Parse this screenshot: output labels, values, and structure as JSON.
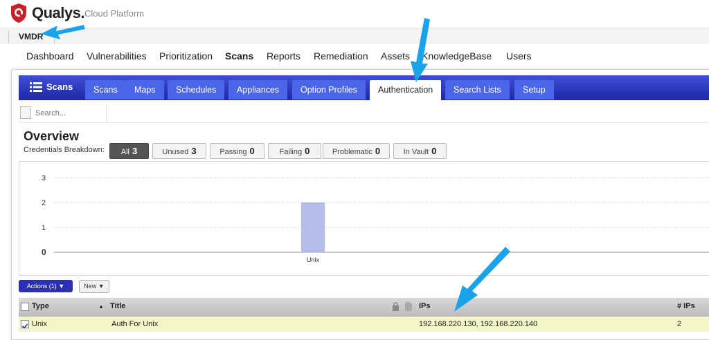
{
  "brand": {
    "name": "Qualys.",
    "suffix": "Cloud Platform",
    "color": "#c5232c"
  },
  "module": {
    "label": "VMDR"
  },
  "topnav": [
    {
      "label": "Dashboard",
      "active": false
    },
    {
      "label": "Vulnerabilities",
      "active": false
    },
    {
      "label": "Prioritization",
      "active": false
    },
    {
      "label": "Scans",
      "active": true
    },
    {
      "label": "Reports",
      "active": false
    },
    {
      "label": "Remediation",
      "active": false
    },
    {
      "label": "Assets",
      "active": false
    },
    {
      "label": "KnowledgeBase",
      "active": false
    },
    {
      "label": "Users",
      "active": false
    }
  ],
  "scans_section": {
    "heading": "Scans"
  },
  "tabs": [
    {
      "label": "Scans",
      "active": false
    },
    {
      "label": "Maps",
      "active": false
    },
    {
      "label": "Schedules",
      "active": false
    },
    {
      "label": "Appliances",
      "active": false
    },
    {
      "label": "Option Profiles",
      "active": false
    },
    {
      "label": "Authentication",
      "active": true
    },
    {
      "label": "Search Lists",
      "active": false
    },
    {
      "label": "Setup",
      "active": false
    }
  ],
  "search": {
    "placeholder": "Search..."
  },
  "overview": {
    "title": "Overview",
    "breakdown_label": "Credentials Breakdown:",
    "filters": [
      {
        "label": "All",
        "count": "3",
        "active": true
      },
      {
        "label": "Unused",
        "count": "3",
        "active": false
      },
      {
        "label": "Passing",
        "count": "0",
        "active": false
      },
      {
        "label": "Failing",
        "count": "0",
        "active": false
      },
      {
        "label": "Problematic",
        "count": "0",
        "active": false
      },
      {
        "label": "In Vault",
        "count": "0",
        "active": false
      }
    ]
  },
  "chart_data": {
    "type": "bar",
    "categories": [
      "Unix"
    ],
    "values": [
      2
    ],
    "ylim": [
      0,
      3
    ],
    "yticks": [
      "0",
      "1",
      "2",
      "3"
    ],
    "grid": true,
    "bar_color": "#b3bde8",
    "title": "",
    "xlabel": "",
    "ylabel": ""
  },
  "actions": {
    "actions_label": "Actions (1)",
    "new_label": "New"
  },
  "table": {
    "columns": {
      "type": "Type",
      "title": "Title",
      "ips": "IPs",
      "num_ips": "# IPs"
    },
    "rows": [
      {
        "type": "Unix",
        "title": "Auth For Unix",
        "ips": "192.168.220.130, 192.168.220.140",
        "num_ips": "2",
        "checked": true
      }
    ]
  },
  "annotation_color": "#1aa3e8"
}
